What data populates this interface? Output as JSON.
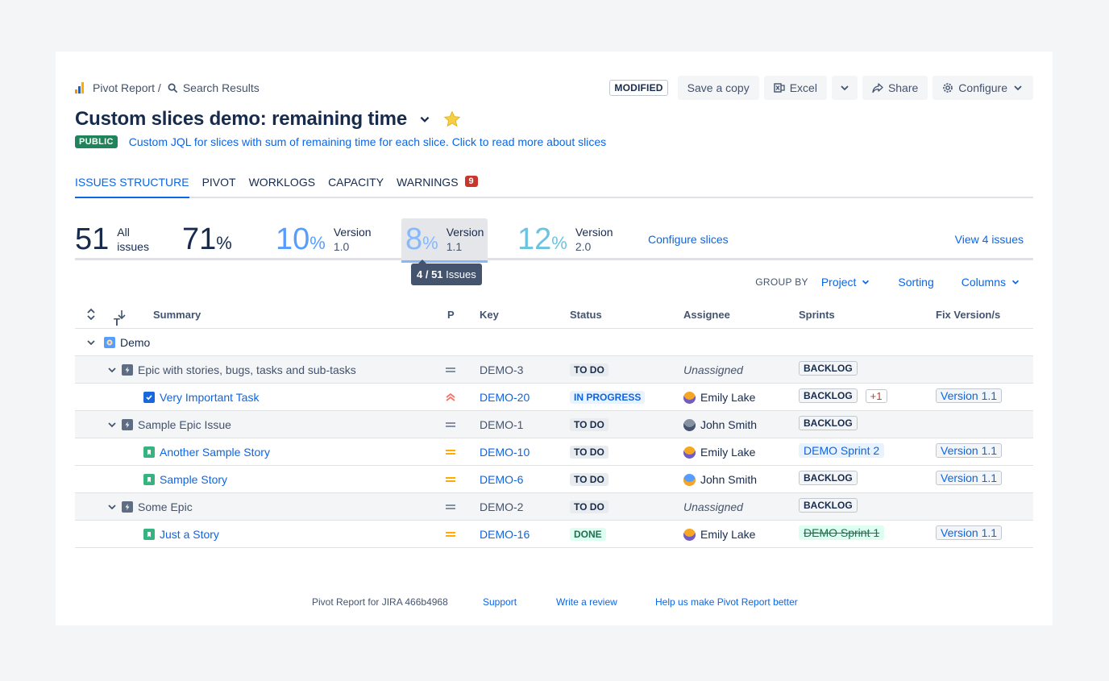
{
  "breadcrumb": {
    "app": "Pivot Report /",
    "page": "Search Results"
  },
  "header": {
    "modified": "MODIFIED",
    "save_copy": "Save a copy",
    "excel": "Excel",
    "share": "Share",
    "configure": "Configure",
    "title": "Custom slices demo: remaining time",
    "public": "PUBLIC",
    "description": "Custom JQL for slices with sum of remaining time for each slice. Click to read more about slices"
  },
  "tabs": [
    {
      "label": "ISSUES STRUCTURE"
    },
    {
      "label": "PIVOT"
    },
    {
      "label": "WORKLOGS"
    },
    {
      "label": "CAPACITY"
    },
    {
      "label": "WARNINGS",
      "count": "9"
    }
  ],
  "slices": [
    {
      "value": "51",
      "unit": "",
      "l1": "All",
      "l2": "issues",
      "color": "#172b4d"
    },
    {
      "value": "71",
      "unit": "%",
      "l1": "",
      "l2": "",
      "color": "#172b4d"
    },
    {
      "value": "10",
      "unit": "%",
      "l1": "Version",
      "l2": "1.0",
      "color": "#579dff"
    },
    {
      "value": "8",
      "unit": "%",
      "l1": "Version",
      "l2": "1.1",
      "color": "#85b8ff"
    },
    {
      "value": "12",
      "unit": "%",
      "l1": "Version",
      "l2": "2.0",
      "color": "#6cc3e0"
    }
  ],
  "configure_slices": "Configure slices",
  "view_issues": "View 4 issues",
  "tooltip": {
    "count": "4 / 51",
    "text": "Issues"
  },
  "groupby": {
    "label": "GROUP BY",
    "project": "Project",
    "sorting": "Sorting",
    "columns": "Columns"
  },
  "columns": {
    "t": "T",
    "summary": "Summary",
    "p": "P",
    "key": "Key",
    "status": "Status",
    "assignee": "Assignee",
    "sprints": "Sprints",
    "fix": "Fix Version/s"
  },
  "project": "Demo",
  "rows": [
    {
      "summary": "Epic with stories, bugs, tasks and sub-tasks",
      "key": "DEMO-3",
      "status": "TO DO",
      "assignee": "Unassigned",
      "sprint": "BACKLOG"
    },
    {
      "summary": "Very Important Task",
      "key": "DEMO-20",
      "status": "IN PROGRESS",
      "assignee": "Emily Lake",
      "sprint": "BACKLOG",
      "extra": "+1",
      "fix": "Version 1.1"
    },
    {
      "summary": "Sample Epic Issue",
      "key": "DEMO-1",
      "status": "TO DO",
      "assignee": "John Smith",
      "sprint": "BACKLOG"
    },
    {
      "summary": "Another Sample Story",
      "key": "DEMO-10",
      "status": "TO DO",
      "assignee": "Emily Lake",
      "sprint": "DEMO Sprint 2",
      "fix": "Version 1.1"
    },
    {
      "summary": "Sample Story",
      "key": "DEMO-6",
      "status": "TO DO",
      "assignee": "John Smith",
      "sprint": "BACKLOG",
      "fix": "Version 1.1"
    },
    {
      "summary": "Some Epic",
      "key": "DEMO-2",
      "status": "TO DO",
      "assignee": "Unassigned",
      "sprint": "BACKLOG"
    },
    {
      "summary": "Just a Story",
      "key": "DEMO-16",
      "status": "DONE",
      "assignee": "Emily Lake",
      "sprint": "DEMO Sprint 1",
      "fix": "Version 1.1"
    }
  ],
  "footer": {
    "version": "Pivot Report for JIRA 466b4968",
    "support": "Support",
    "review": "Write a review",
    "improve": "Help us make Pivot Report better"
  }
}
